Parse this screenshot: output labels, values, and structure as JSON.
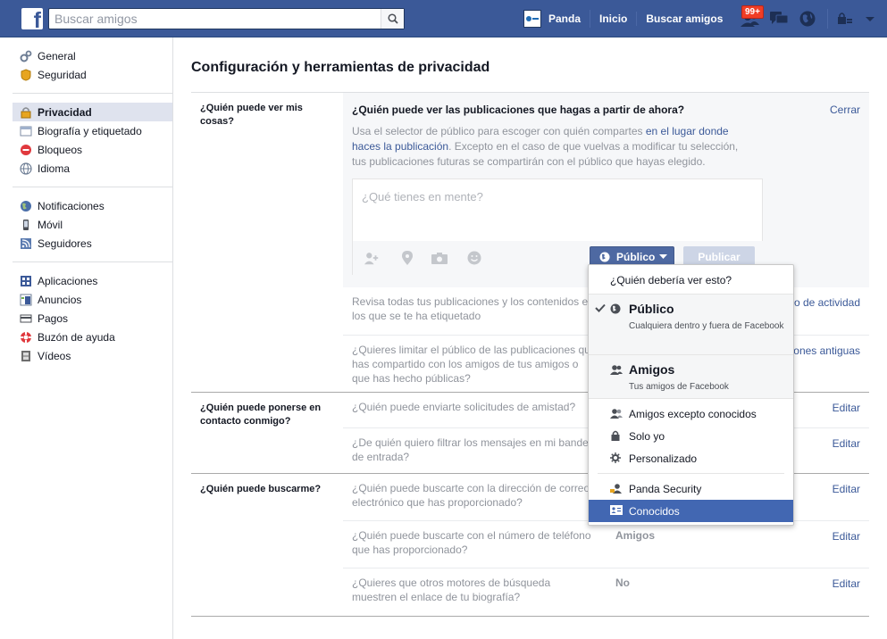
{
  "topbar": {
    "search_placeholder": "Buscar amigos",
    "profile_name": "Panda",
    "nav_home": "Inicio",
    "nav_find_friends": "Buscar amigos",
    "friend_requests_badge": "99+"
  },
  "sidebar": {
    "groups": [
      [
        {
          "label": "General",
          "icon": "gears-icon"
        },
        {
          "label": "Seguridad",
          "icon": "badge-icon"
        }
      ],
      [
        {
          "label": "Privacidad",
          "icon": "lock-icon",
          "active": true
        },
        {
          "label": "Biografía y etiquetado",
          "icon": "timeline-icon"
        },
        {
          "label": "Bloqueos",
          "icon": "block-icon"
        },
        {
          "label": "Idioma",
          "icon": "globe-icon"
        }
      ],
      [
        {
          "label": "Notificaciones",
          "icon": "globe-icon"
        },
        {
          "label": "Móvil",
          "icon": "mobile-icon"
        },
        {
          "label": "Seguidores",
          "icon": "rss-icon"
        }
      ],
      [
        {
          "label": "Aplicaciones",
          "icon": "apps-icon"
        },
        {
          "label": "Anuncios",
          "icon": "ads-icon"
        },
        {
          "label": "Pagos",
          "icon": "payments-icon"
        },
        {
          "label": "Buzón de ayuda",
          "icon": "lifebuoy-icon"
        },
        {
          "label": "Vídeos",
          "icon": "film-icon"
        }
      ]
    ]
  },
  "main": {
    "title": "Configuración y herramientas de privacidad",
    "section1": {
      "label": "¿Quién puede ver mis cosas?",
      "expanded_question": "¿Quién puede ver las publicaciones que hagas a partir de ahora?",
      "close": "Cerrar",
      "desc_pre": "Usa el selector de público para escoger con quién compartes ",
      "desc_link": "en el lugar donde haces la publicación",
      "desc_post": ". Excepto en el caso de que vuelvas a modificar tu selección, tus publicaciones futuras se compartirán con el público que hayas elegido.",
      "composer_placeholder": "¿Qué tienes en mente?",
      "audience_button": "Público",
      "publish_button": "Publicar",
      "row2_q": "Revisa todas tus publicaciones y los contenidos en los que se te ha etiquetado",
      "row2_link": "o de actividad",
      "row3_q": "¿Quieres limitar el público de las publicaciones que has compartido con los amigos de tus amigos o que has hecho públicas?",
      "row3_link": "ones antiguas"
    },
    "section2": {
      "label": "¿Quién puede ponerse en contacto conmigo?",
      "row1_q": "¿Quién puede enviarte solicitudes de amistad?",
      "row1_edit": "Editar",
      "row2_q": "¿De quién quiero filtrar los mensajes en mi bandeja de entrada?",
      "row2_edit": "Editar"
    },
    "section3": {
      "label": "¿Quién puede buscarme?",
      "row1_q": "¿Quién puede buscarte con la dirección de correo electrónico que has proporcionado?",
      "row1_edit": "Editar",
      "row2_q": "¿Quién puede buscarte con el número de teléfono que has proporcionado?",
      "row2_val": "Amigos",
      "row2_edit": "Editar",
      "row3_q": "¿Quieres que otros motores de búsqueda muestren el enlace de tu biografía?",
      "row3_val": "No",
      "row3_edit": "Editar"
    }
  },
  "dropdown": {
    "header": "¿Quién debería ver esto?",
    "public_title": "Público",
    "public_sub": "Cualquiera dentro y fuera de Facebook",
    "friends_title": "Amigos",
    "friends_sub": "Tus amigos de Facebook",
    "friends_except": "Amigos excepto conocidos",
    "only_me": "Solo yo",
    "custom": "Personalizado",
    "panda_security": "Panda Security",
    "acquaintances": "Conocidos"
  },
  "colors": {
    "brand": "#3b5998",
    "highlight": "#4267b2",
    "badge": "#f03d25"
  }
}
